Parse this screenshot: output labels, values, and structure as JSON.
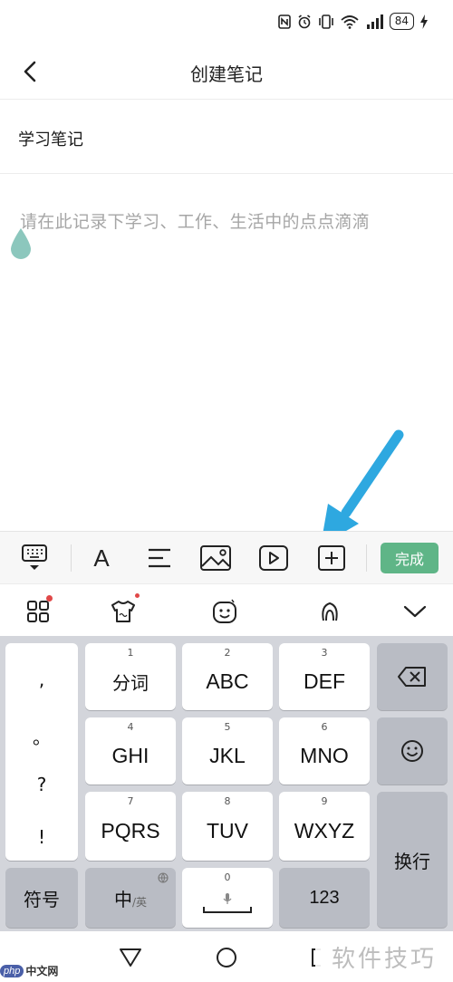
{
  "status_bar": {
    "battery": "84"
  },
  "header": {
    "title": "创建笔记"
  },
  "note": {
    "title": "学习笔记",
    "placeholder": "请在此记录下学习、工作、生活中的点点滴滴"
  },
  "format_toolbar": {
    "font_label": "A",
    "done_label": "完成",
    "done_color": "#5fb587"
  },
  "keyboard": {
    "punctuation": [
      ",",
      "。",
      "?",
      "!"
    ],
    "rows": [
      [
        {
          "num": "1",
          "label": "分词"
        },
        {
          "num": "2",
          "label": "ABC"
        },
        {
          "num": "3",
          "label": "DEF"
        }
      ],
      [
        {
          "num": "4",
          "label": "GHI"
        },
        {
          "num": "5",
          "label": "JKL"
        },
        {
          "num": "6",
          "label": "MNO"
        }
      ],
      [
        {
          "num": "7",
          "label": "PQRS"
        },
        {
          "num": "8",
          "label": "TUV"
        },
        {
          "num": "9",
          "label": "WXYZ"
        }
      ]
    ],
    "symbols_label": "符号",
    "lang_main": "中",
    "lang_sub": "/英",
    "space_num": "0",
    "num_label": "123",
    "enter_label": "换行"
  },
  "watermark": {
    "brand": "php",
    "site": "中文网",
    "right_text": "软件技巧"
  },
  "colors": {
    "accent_arrow": "#2ea8e0",
    "cursor_drop": "#8cc7bd"
  }
}
